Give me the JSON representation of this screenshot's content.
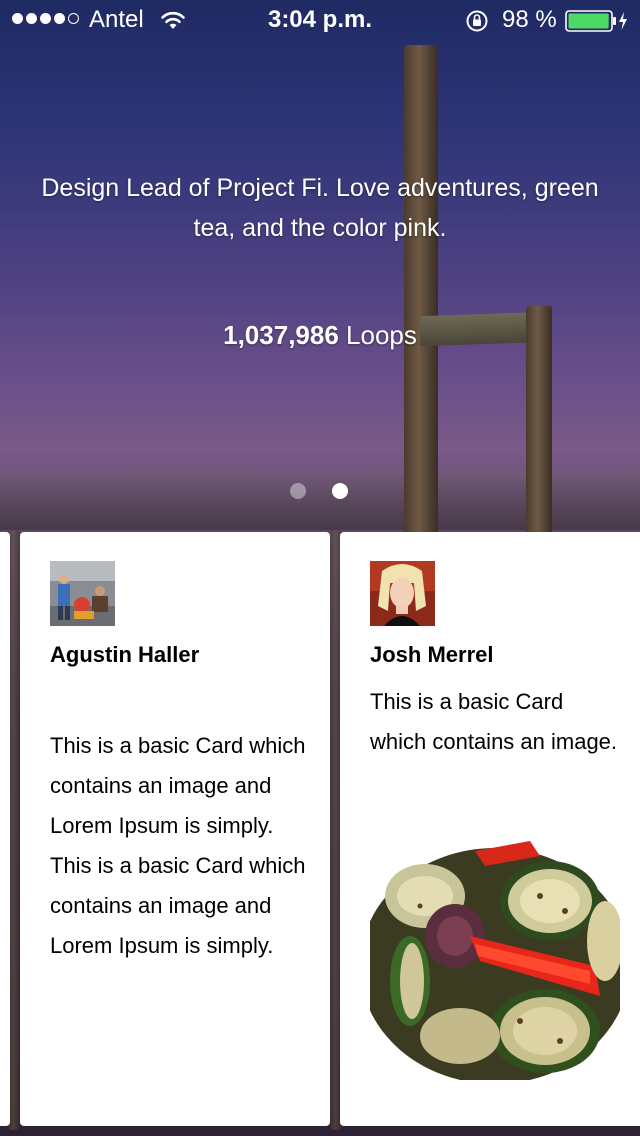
{
  "status_bar": {
    "carrier": "Antel",
    "time": "3:04 p.m.",
    "battery_percent": "98 %",
    "signal_bars": 4,
    "signal_max": 5,
    "battery_level": 0.98,
    "icons": [
      "wifi-icon",
      "rotation-lock-icon",
      "battery-icon",
      "charging-bolt-icon"
    ]
  },
  "profile": {
    "bio": "Design Lead of Project Fi. Love adventures, green tea, and the color pink.",
    "loops_count": "1,037,986",
    "loops_label": "Loops"
  },
  "pager": {
    "total": 2,
    "active_index": 1
  },
  "cards": [
    {
      "name": "Agustin Haller",
      "body": "This is a basic Card which contains an image and Lorem Ipsum is simply. This is a basic Card which contains an image and Lorem Ipsum is simply.",
      "avatar": "avatar-photo"
    },
    {
      "name": "Josh Merrel",
      "body": "This is a basic Card which contains an image.",
      "avatar": "avatar-photo",
      "image": "grilled-vegetables-photo"
    }
  ],
  "colors": {
    "battery_fill": "#4cd964",
    "card_background": "#ffffff",
    "text_on_hero": "#ffffff"
  }
}
